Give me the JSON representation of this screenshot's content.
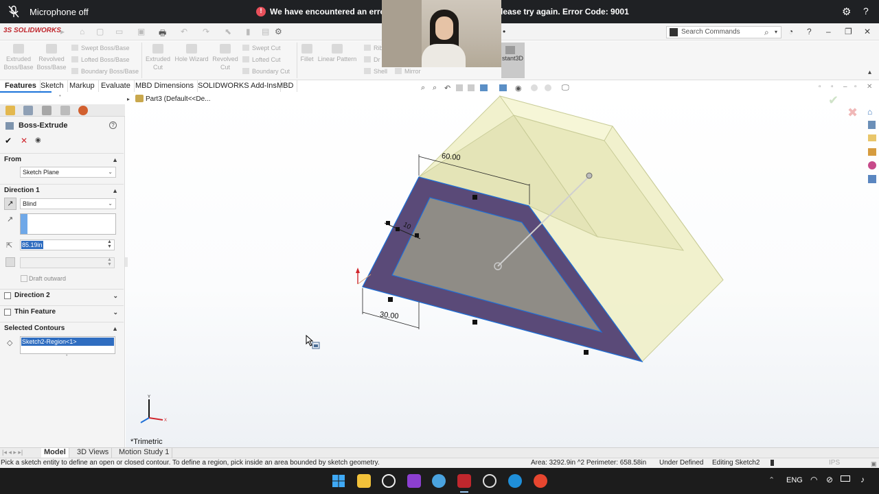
{
  "notification": {
    "mic_status": "Microphone off",
    "error_part1": "We have encountered an error",
    "error_part2": "lease try again. Error Code: 9001"
  },
  "app": {
    "logo_text": "SOLIDWORKS",
    "search_placeholder": "Search Commands"
  },
  "ribbon": {
    "buttons": [
      {
        "label": "Extruded Boss/Base"
      },
      {
        "label": "Revolved Boss/Base"
      },
      {
        "label": "Swept Boss/Base"
      },
      {
        "label": "Lofted Boss/Base"
      },
      {
        "label": "Boundary Boss/Base"
      },
      {
        "label": "Extruded Cut"
      },
      {
        "label": "Hole Wizard"
      },
      {
        "label": "Revolved Cut"
      },
      {
        "label": "Swept Cut"
      },
      {
        "label": "Lofted Cut"
      },
      {
        "label": "Boundary Cut"
      },
      {
        "label": "Fillet"
      },
      {
        "label": "Linear Pattern"
      },
      {
        "label": "Rib"
      },
      {
        "label": "Dr"
      },
      {
        "label": "Shell"
      },
      {
        "label": "Mirror"
      },
      {
        "label": "stant3D"
      }
    ]
  },
  "tabs": [
    "Features",
    "Sketch",
    "Markup",
    "Evaluate",
    "MBD Dimensions",
    "SOLIDWORKS Add-Ins",
    "MBD"
  ],
  "feature_tree": {
    "part_label": "Part3  (Default<<De..."
  },
  "property_manager": {
    "title": "Boss-Extrude",
    "from_header": "From",
    "from_value": "Sketch Plane",
    "direction1_header": "Direction 1",
    "end_condition": "Blind",
    "depth_value": "85.19in",
    "draft_outward": "Draft outward",
    "direction2_header": "Direction 2",
    "thin_feature_header": "Thin Feature",
    "selected_contours_header": "Selected Contours",
    "selected_contour": "Sketch2-Region<1>"
  },
  "viewport": {
    "dim_top": "60.00",
    "dim_side": "10",
    "dim_bottom": "30.00",
    "view_name": "*Trimetric"
  },
  "bottom_tabs": [
    "Model",
    "3D Views",
    "Motion Study 1"
  ],
  "status_bar": {
    "hint": "Pick a sketch entity to define an open or closed contour. To define a region, pick inside an area bounded by sketch geometry.",
    "area": "Area: 3292.9in ^2 Perimeter: 658.58in",
    "state": "Under Defined",
    "editing": "Editing Sketch2",
    "units": "IPS"
  },
  "taskbar": {
    "language": "ENG"
  },
  "colors": {
    "accent_blue": "#1a73d9",
    "selection_blue": "#1f6fd6",
    "preview_yellow": "#efefc4",
    "profile_purple": "#5a4a78",
    "error_red": "#e8505b"
  }
}
